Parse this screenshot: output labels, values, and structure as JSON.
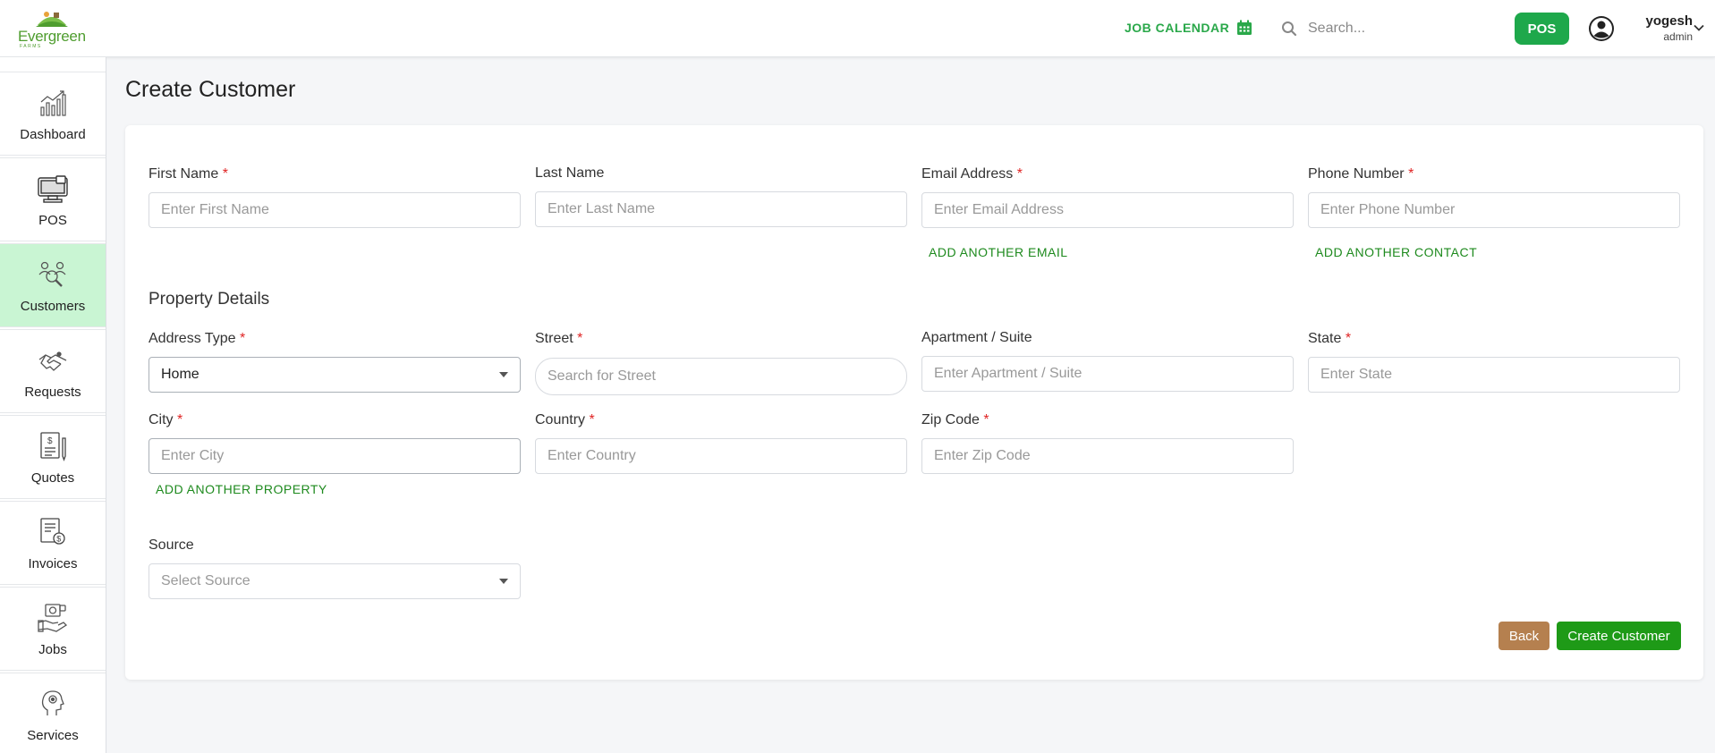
{
  "header": {
    "logo_text": "Evergreen",
    "logo_sub": "FARMS",
    "job_calendar_label": "JOB CALENDAR",
    "search_placeholder": "Search...",
    "pos_button_label": "POS",
    "user_name": "yogesh",
    "user_role": "admin"
  },
  "sidebar": {
    "items": [
      {
        "label": "Dashboard",
        "icon": "chart-icon"
      },
      {
        "label": "POS",
        "icon": "pos-terminal-icon"
      },
      {
        "label": "Customers",
        "icon": "customers-search-icon",
        "active": true
      },
      {
        "label": "Requests",
        "icon": "handshake-icon"
      },
      {
        "label": "Quotes",
        "icon": "quote-document-icon"
      },
      {
        "label": "Invoices",
        "icon": "invoice-icon"
      },
      {
        "label": "Jobs",
        "icon": "jobs-hand-icon"
      },
      {
        "label": "Services",
        "icon": "service-head-icon"
      }
    ],
    "active_color": "#c9f5d3"
  },
  "page": {
    "title": "Create Customer"
  },
  "form": {
    "first_name": {
      "label": "First Name",
      "placeholder": "Enter First Name",
      "required": "*"
    },
    "last_name": {
      "label": "Last Name",
      "placeholder": "Enter Last Name"
    },
    "email": {
      "label": "Email Address",
      "placeholder": "Enter Email Address",
      "required": "*"
    },
    "phone": {
      "label": "Phone Number",
      "placeholder": "Enter Phone Number",
      "required": "*"
    },
    "add_email_link": "ADD ANOTHER EMAIL",
    "add_contact_link": "ADD ANOTHER CONTACT",
    "property_section_title": "Property Details",
    "address_type": {
      "label": "Address Type",
      "value": "Home",
      "required": "*"
    },
    "street": {
      "label": "Street",
      "placeholder": "Search for Street",
      "required": "*"
    },
    "apartment": {
      "label": "Apartment / Suite",
      "placeholder": "Enter Apartment / Suite"
    },
    "state": {
      "label": "State",
      "placeholder": "Enter State",
      "required": "*"
    },
    "city": {
      "label": "City",
      "placeholder": "Enter City",
      "required": "*"
    },
    "country": {
      "label": "Country",
      "placeholder": "Enter Country",
      "required": "*"
    },
    "zip": {
      "label": "Zip Code",
      "placeholder": "Enter Zip Code",
      "required": "*"
    },
    "add_property_link": "ADD ANOTHER PROPERTY",
    "source": {
      "label": "Source",
      "placeholder": "Select Source"
    },
    "back_button": "Back",
    "create_button": "Create Customer"
  },
  "colors": {
    "brand_green": "#1ea84b",
    "link_green": "#1e8a1e",
    "back_brown": "#b5804f",
    "create_green": "#1e9a17",
    "required_red": "#e02424"
  }
}
